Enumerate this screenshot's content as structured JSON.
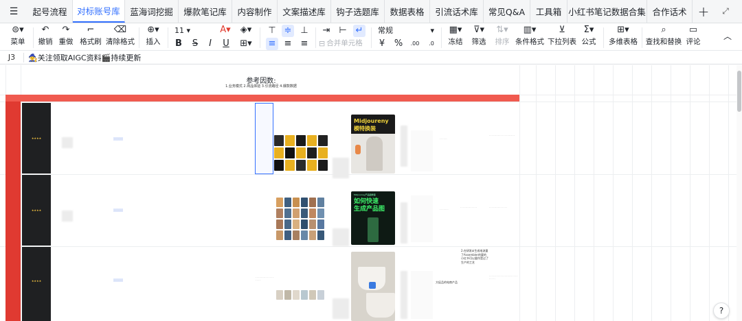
{
  "tabs": {
    "items": [
      {
        "label": "起号流程"
      },
      {
        "label": "对标账号库",
        "active": true
      },
      {
        "label": "蓝海词挖掘"
      },
      {
        "label": "爆款笔记库"
      },
      {
        "label": "内容制作"
      },
      {
        "label": "文案描述库"
      },
      {
        "label": "钩子选题库"
      },
      {
        "label": "数据表格"
      },
      {
        "label": "引流话术库"
      },
      {
        "label": "常见Q&A"
      },
      {
        "label": "工具箱"
      },
      {
        "label": "小红书笔记数据合集"
      },
      {
        "label": "合作话术"
      }
    ],
    "add_icon": "plus-icon",
    "expand_icon": "expand-icon"
  },
  "toolbar": {
    "menu": "菜单",
    "undo": "撤销",
    "redo": "重做",
    "format_painter": "格式刷",
    "clear_format": "清除格式",
    "insert": "插入",
    "font_size": "11",
    "merge_cells": "合并单元格",
    "number_format": "常规",
    "freeze": "冻结",
    "filter": "筛选",
    "sort": "排序",
    "conditional_format": "条件格式",
    "dropdown_list": "下拉列表",
    "formula": "公式",
    "multi_table": "多维表格",
    "find_replace": "查找和替换",
    "comment": "评论",
    "currency_symbol": "¥",
    "percent_symbol": "%",
    "decimal_add": ".00",
    "decimal_remove": ".0",
    "accent_color": "#3370ff"
  },
  "formula_bar": {
    "cell_ref": "J3",
    "content": "🧙关注领取AIGC资料🎬持续更新"
  },
  "sheet": {
    "ref_title": "参考因数:",
    "ref_sub": "1.业务模式  2.商品体验  3.引流路径  4.爆款数据",
    "header_color": "#f05a4f",
    "stars": "★★★★",
    "posters": [
      {
        "title": "Midjoureny\n模特换装"
      },
      {
        "title": "如何快速\n生成产品图",
        "kicker": "Midjourney产品图教程"
      }
    ],
    "notes": [
      "2.在研发ai生成电流量了Assembler的要的小红书可以要作是过了生产的工艺",
      "大促品的电商产品"
    ]
  },
  "help_label": "?"
}
